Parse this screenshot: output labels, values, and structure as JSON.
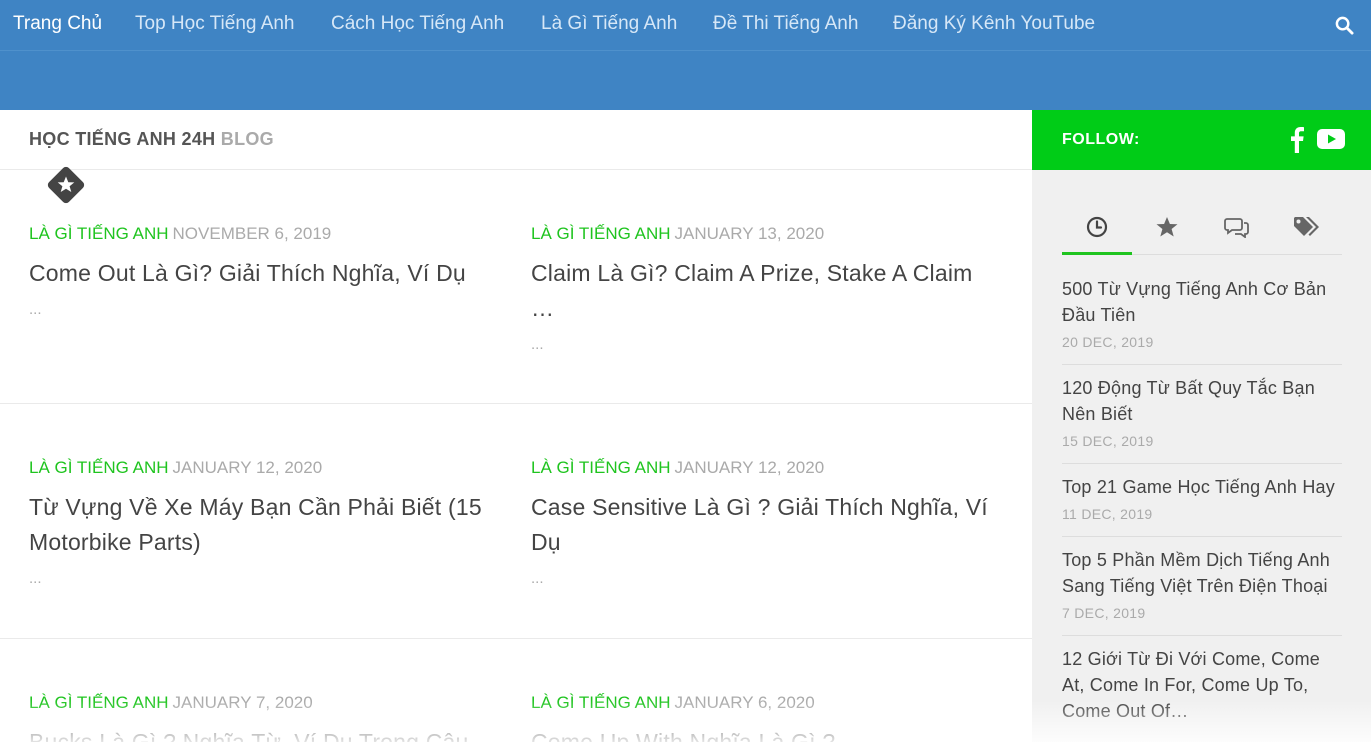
{
  "nav": {
    "items": [
      {
        "label": "Trang Chủ"
      },
      {
        "label": "Top Học Tiếng Anh"
      },
      {
        "label": "Cách Học Tiếng Anh"
      },
      {
        "label": "Là Gì Tiếng Anh"
      },
      {
        "label": "Đề Thi Tiếng Anh"
      },
      {
        "label": "Đăng Ký Kênh YouTube"
      }
    ],
    "search_icon": "search-icon"
  },
  "page_title": {
    "primary": "HỌC TIẾNG ANH 24H",
    "secondary": "BLOG",
    "badge_icon": "star-icon"
  },
  "posts": [
    {
      "category": "LÀ GÌ TIẾNG ANH",
      "date": "NOVEMBER 6, 2019",
      "title": "Come Out Là Gì? Giải Thích Nghĩa, Ví Dụ",
      "excerpt": "..."
    },
    {
      "category": "LÀ GÌ TIẾNG ANH",
      "date": "JANUARY 13, 2020",
      "title": "Claim Là Gì? Claim A Prize, Stake A Claim …",
      "excerpt": "..."
    },
    {
      "category": "LÀ GÌ TIẾNG ANH",
      "date": "JANUARY 12, 2020",
      "title": "Từ Vựng Về Xe Máy Bạn Cần Phải Biết (15 Motorbike Parts)",
      "excerpt": "..."
    },
    {
      "category": "LÀ GÌ TIẾNG ANH",
      "date": "JANUARY 12, 2020",
      "title": "Case Sensitive Là Gì ? Giải Thích Nghĩa, Ví Dụ",
      "excerpt": "..."
    },
    {
      "category": "LÀ GÌ TIẾNG ANH",
      "date": "JANUARY 7, 2020",
      "title": "Bucks Là Gì ? Nghĩa Từ, Ví Dụ Trong Câu",
      "excerpt": ""
    },
    {
      "category": "LÀ GÌ TIẾNG ANH",
      "date": "JANUARY 6, 2020",
      "title": "Come Up With Nghĩa Là Gì ?",
      "excerpt": ""
    }
  ],
  "sidebar": {
    "follow_label": "FOLLOW:",
    "social_icons": [
      "facebook-icon",
      "youtube-icon"
    ],
    "tabs": [
      {
        "icon": "clock-icon"
      },
      {
        "icon": "star-icon"
      },
      {
        "icon": "comments-icon"
      },
      {
        "icon": "tags-icon"
      }
    ],
    "items": [
      {
        "title": "500 Từ Vựng Tiếng Anh Cơ Bản Đầu Tiên",
        "date": "20 DEC, 2019"
      },
      {
        "title": "120 Động Từ Bất Quy Tắc Bạn Nên Biết",
        "date": "15 DEC, 2019"
      },
      {
        "title": "Top 21 Game Học Tiếng Anh Hay",
        "date": "11 DEC, 2019"
      },
      {
        "title": "Top 5 Phần Mềm Dịch Tiếng Anh Sang Tiếng Việt Trên Điện Thoại",
        "date": "7 DEC, 2019"
      },
      {
        "title": "12 Giới Từ Đi Với Come, Come At, Come In For, Come Up To, Come Out Of…",
        "date": ""
      }
    ]
  },
  "colors": {
    "nav_bg": "#3f84c4",
    "accent_green": "#1fc41f",
    "follow_bg": "#00cc17"
  }
}
